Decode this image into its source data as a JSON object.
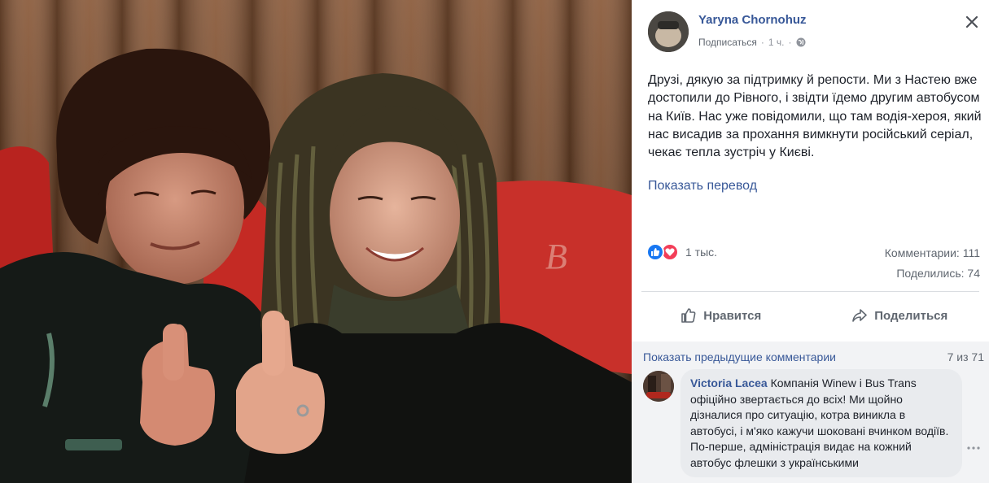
{
  "post": {
    "author": "Yaryna Chornohuz",
    "follow_label": "Подписаться",
    "separator": "·",
    "time": "1 ч.",
    "text": "Друзі, дякую за підтримку й репости. Ми з Настею вже достопили до Рівного, і звідти їдемо другим автобусом на Київ. Нас уже повідомили, що там водія-хероя, який нас висадив за прохання вимкнути російський серіал, чекає тепла зустріч у Києві.",
    "translate_label": "Показать перевод"
  },
  "stats": {
    "reactions_count": "1 тыс.",
    "comments_label": "Комментарии: 111",
    "shares_label": "Поделились: 74"
  },
  "actions": {
    "like_label": "Нравится",
    "share_label": "Поделиться"
  },
  "comments": {
    "prev_label": "Показать предыдущие комментарии",
    "pager": "7 из 71",
    "items": [
      {
        "author": "Victoria Lacea",
        "text": " Компанія Winew і Bus Trans офіційно звертається до всіх! Ми щойно дізналися про ситуацію, котра виникла в автобусі, і м'яко кажучи шоковані вчинком водіїв. По-перше, адміністрація видає на кожний автобус флешки з українськими"
      }
    ]
  },
  "icons": {
    "globe": "globe-icon",
    "close": "close-icon",
    "like_reaction": "like-reaction-icon",
    "love_reaction": "love-reaction-icon",
    "like": "thumbs-up-icon",
    "share": "share-arrow-icon",
    "more": "more-options-icon"
  },
  "colors": {
    "link": "#385898",
    "secondary_text": "#606770",
    "like_blue": "#1877f2",
    "love_red": "#f33e58",
    "comments_bg": "#f2f3f5",
    "bubble_bg": "#e9ebee"
  }
}
